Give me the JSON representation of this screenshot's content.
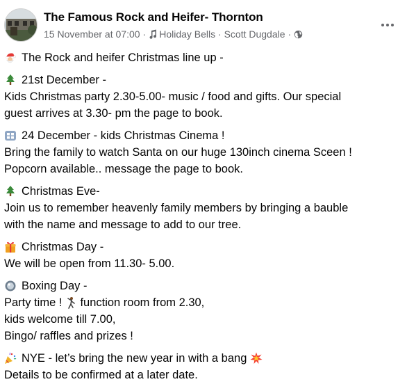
{
  "post": {
    "author": "The Famous Rock and Heifer- Thornton",
    "date": "15 November at 07:00",
    "separator": "·",
    "music": "Holiday Bells · Scott Dugdale",
    "audience_icon": "globe-icon",
    "more_icon": "more-options-icon"
  },
  "content": {
    "intro": "The Rock and heifer Christmas line up -",
    "kids_party_heading": "21st December -",
    "kids_party_line1": "Kids Christmas party 2.30-5.00- music / food and gifts. Our special",
    "kids_party_line2": "guest arrives at 3.30- pm the page to book.",
    "cinema_heading": "24 December - kids Christmas Cinema !",
    "cinema_line1": "Bring the family to watch Santa on our huge 130inch cinema Sceen !",
    "cinema_line2": "Popcorn available.. message the page to book.",
    "eve_heading": "Christmas Eve-",
    "eve_line1": "Join us to remember heavenly family members by bringing a bauble",
    "eve_line2": "with the name and message to add to our tree.",
    "day_heading": "Christmas Day -",
    "day_line1": "We will be open from 11.30- 5.00.",
    "boxing_heading": "Boxing Day -",
    "boxing_line1a": "Party  time !",
    "boxing_line1b": "function room from 2.30,",
    "boxing_line2": "kids welcome till 7.00,",
    "boxing_line3": "Bingo/ raffles and prizes !",
    "nye_heading": "NYE - let’s bring the new year in with a bang",
    "nye_line1": "Details to be confirmed at a later date."
  },
  "icons": {
    "santa": "santa-emoji-icon",
    "tree": "christmas-tree-emoji-icon",
    "film": "film-frames-emoji-icon",
    "gift": "gift-emoji-icon",
    "bauble": "bauble-emoji-icon",
    "dancer": "dancing-emoji-icon",
    "party_popper": "party-popper-emoji-icon",
    "collision": "collision-emoji-icon"
  },
  "colors": {
    "text": "#050505",
    "secondary": "#65676b"
  }
}
